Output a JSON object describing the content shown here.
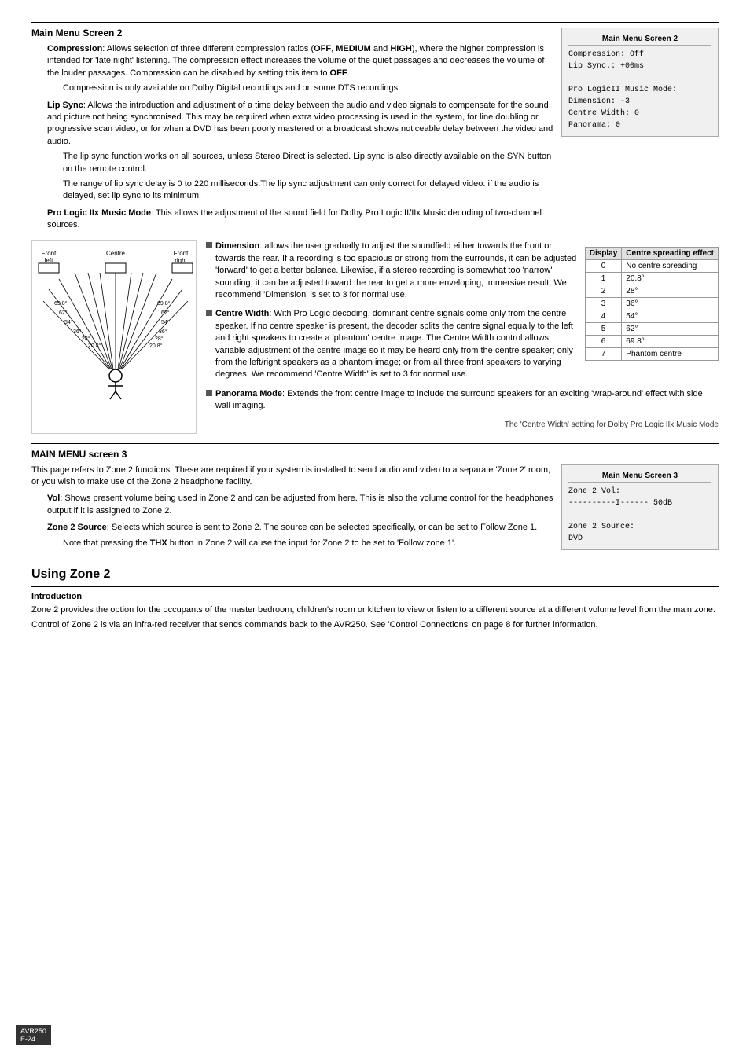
{
  "screen2": {
    "title": "Main Menu Screen 2",
    "hr": true,
    "compression_title": "Compression",
    "compression_text1": ": Allows selection of three different compression ratios (",
    "compression_off": "OFF",
    "compression_comma": ", ",
    "compression_medium": "MEDIUM",
    "compression_and": " and ",
    "compression_high": "HIGH",
    "compression_text2": "), where the higher compression is intended for 'late night' listening. The compression effect increases the volume of the quiet passages and decreases the volume of the louder passages. Compression can be disabled by setting this item to ",
    "compression_off2": "OFF",
    "compression_text3": ".",
    "compression_text4": "Compression is only available on Dolby Digital recordings and on some DTS recordings.",
    "lip_sync_title": "Lip Sync",
    "lip_sync_text1": ": Allows the introduction and adjustment of a time delay between the audio and video signals to compensate for the sound and picture not being synchronised. This may be required when extra video processing is used in the system, for line doubling or progressive scan video, or for when a DVD has been poorly mastered or a broadcast shows noticeable delay between the video and audio.",
    "lip_sync_text2": "The lip sync function works on all sources, unless Stereo Direct is selected. Lip sync is also directly available on the SYN button on the remote control.",
    "lip_sync_text3": "The range of lip sync delay is 0 to 220 milliseconds.The lip sync adjustment can only correct for delayed video: if the audio is delayed, set lip sync to its minimum.",
    "pro_logic_title": "Pro Logic IIx Music Mode",
    "pro_logic_text": ": This allows the adjustment of the sound field for Dolby Pro Logic II/IIx Music decoding of two-channel sources.",
    "infobox": {
      "title": "Main Menu Screen 2",
      "line1": "Compression:  Off",
      "line2": "Lip Sync.:    +00ms",
      "line3": "",
      "line4": "Pro LogicII Music Mode:",
      "line5": "  Dimension:    -3",
      "line6": "  Centre Width:  0",
      "line7": "  Panorama:      0"
    }
  },
  "dimension": {
    "title": "Dimension",
    "text": ": allows the user gradually to adjust the soundfield either towards the front or towards the rear. If a recording is too spacious or strong from the surrounds, it can be adjusted 'forward' to get a better balance. Likewise, if a stereo recording is somewhat too 'narrow' sounding, it can be adjusted toward the rear to get a more enveloping, immersive result. We recommend 'Dimension' is set to 3 for normal use."
  },
  "centre_width": {
    "title": "Centre Width",
    "text": ": With Pro Logic decoding, dominant centre signals come only from the centre speaker. If no centre speaker is present, the decoder splits the centre signal equally to the left and right speakers to create a 'phantom' centre image. The Centre Width control allows variable adjustment of the centre image so it may be heard only from the centre speaker; only from the left/right speakers as a phantom image; or from all three front speakers to varying degrees. We recommend 'Centre Width' is set to 3 for normal use.",
    "table_headers": [
      "Display",
      "Centre spreading effect"
    ],
    "table_rows": [
      [
        "0",
        "No centre spreading"
      ],
      [
        "1",
        "20.8°"
      ],
      [
        "2",
        "28°"
      ],
      [
        "3",
        "36°"
      ],
      [
        "4",
        "54°"
      ],
      [
        "5",
        "62°"
      ],
      [
        "6",
        "69.8°"
      ],
      [
        "7",
        "Phantom centre"
      ]
    ],
    "caption": "The 'Centre Width' setting for Dolby Pro Logic IIx Music Mode"
  },
  "panorama": {
    "title": "Panorama Mode",
    "text": ": Extends the front centre image to include the surround speakers for an exciting 'wrap-around' effect with side wall imaging."
  },
  "diagram": {
    "front_left": "Front left",
    "centre": "Centre",
    "front_right": "Front right",
    "angles": [
      "69.8°",
      "62°",
      "54°",
      "36°",
      "28°",
      "20.8°"
    ],
    "angles_right": [
      "69.8°",
      "62°",
      "54°",
      "36°",
      "28°",
      "20.8°"
    ]
  },
  "screen3": {
    "title": "MAIN MENU screen 3",
    "intro": "This page refers to Zone 2 functions. These are required if your system is installed to send audio and video to a separate 'Zone 2' room, or you wish to make use of the Zone 2 headphone facility.",
    "vol_title": "Vol",
    "vol_text": ": Shows present volume being used in Zone 2 and can be adjusted from here. This is also the volume control for the headphones output if it is assigned to Zone 2.",
    "zone2_source_title": "Zone 2 Source",
    "zone2_source_text": ": Selects which source is sent to Zone 2. The source can be selected specifically, or can be set to Follow Zone 1.",
    "zone2_source_note": "Note that pressing the ",
    "zone2_thx": "THX",
    "zone2_source_note2": " button in Zone 2 will cause the input for Zone 2 to be set to 'Follow zone 1'.",
    "infobox": {
      "title": "Main Menu Screen 3",
      "line1": "Zone 2 Vol:",
      "line2": "----------I------  50dB",
      "line3": "",
      "line4": "Zone 2 Source:",
      "line5": "    DVD"
    }
  },
  "using_zone2": {
    "title": "Using Zone 2",
    "intro_title": "Introduction",
    "intro_text1": "Zone 2 provides the option for the occupants of the master bedroom, children's room or kitchen to view or listen to a different source at a different volume level from the main zone.",
    "intro_text2": "Control of Zone 2 is via an infra-red receiver that sends commands back to the AVR250. See 'Control Connections' on page 8 for further information."
  },
  "footer": {
    "model": "AVR250",
    "page": "E-24"
  }
}
